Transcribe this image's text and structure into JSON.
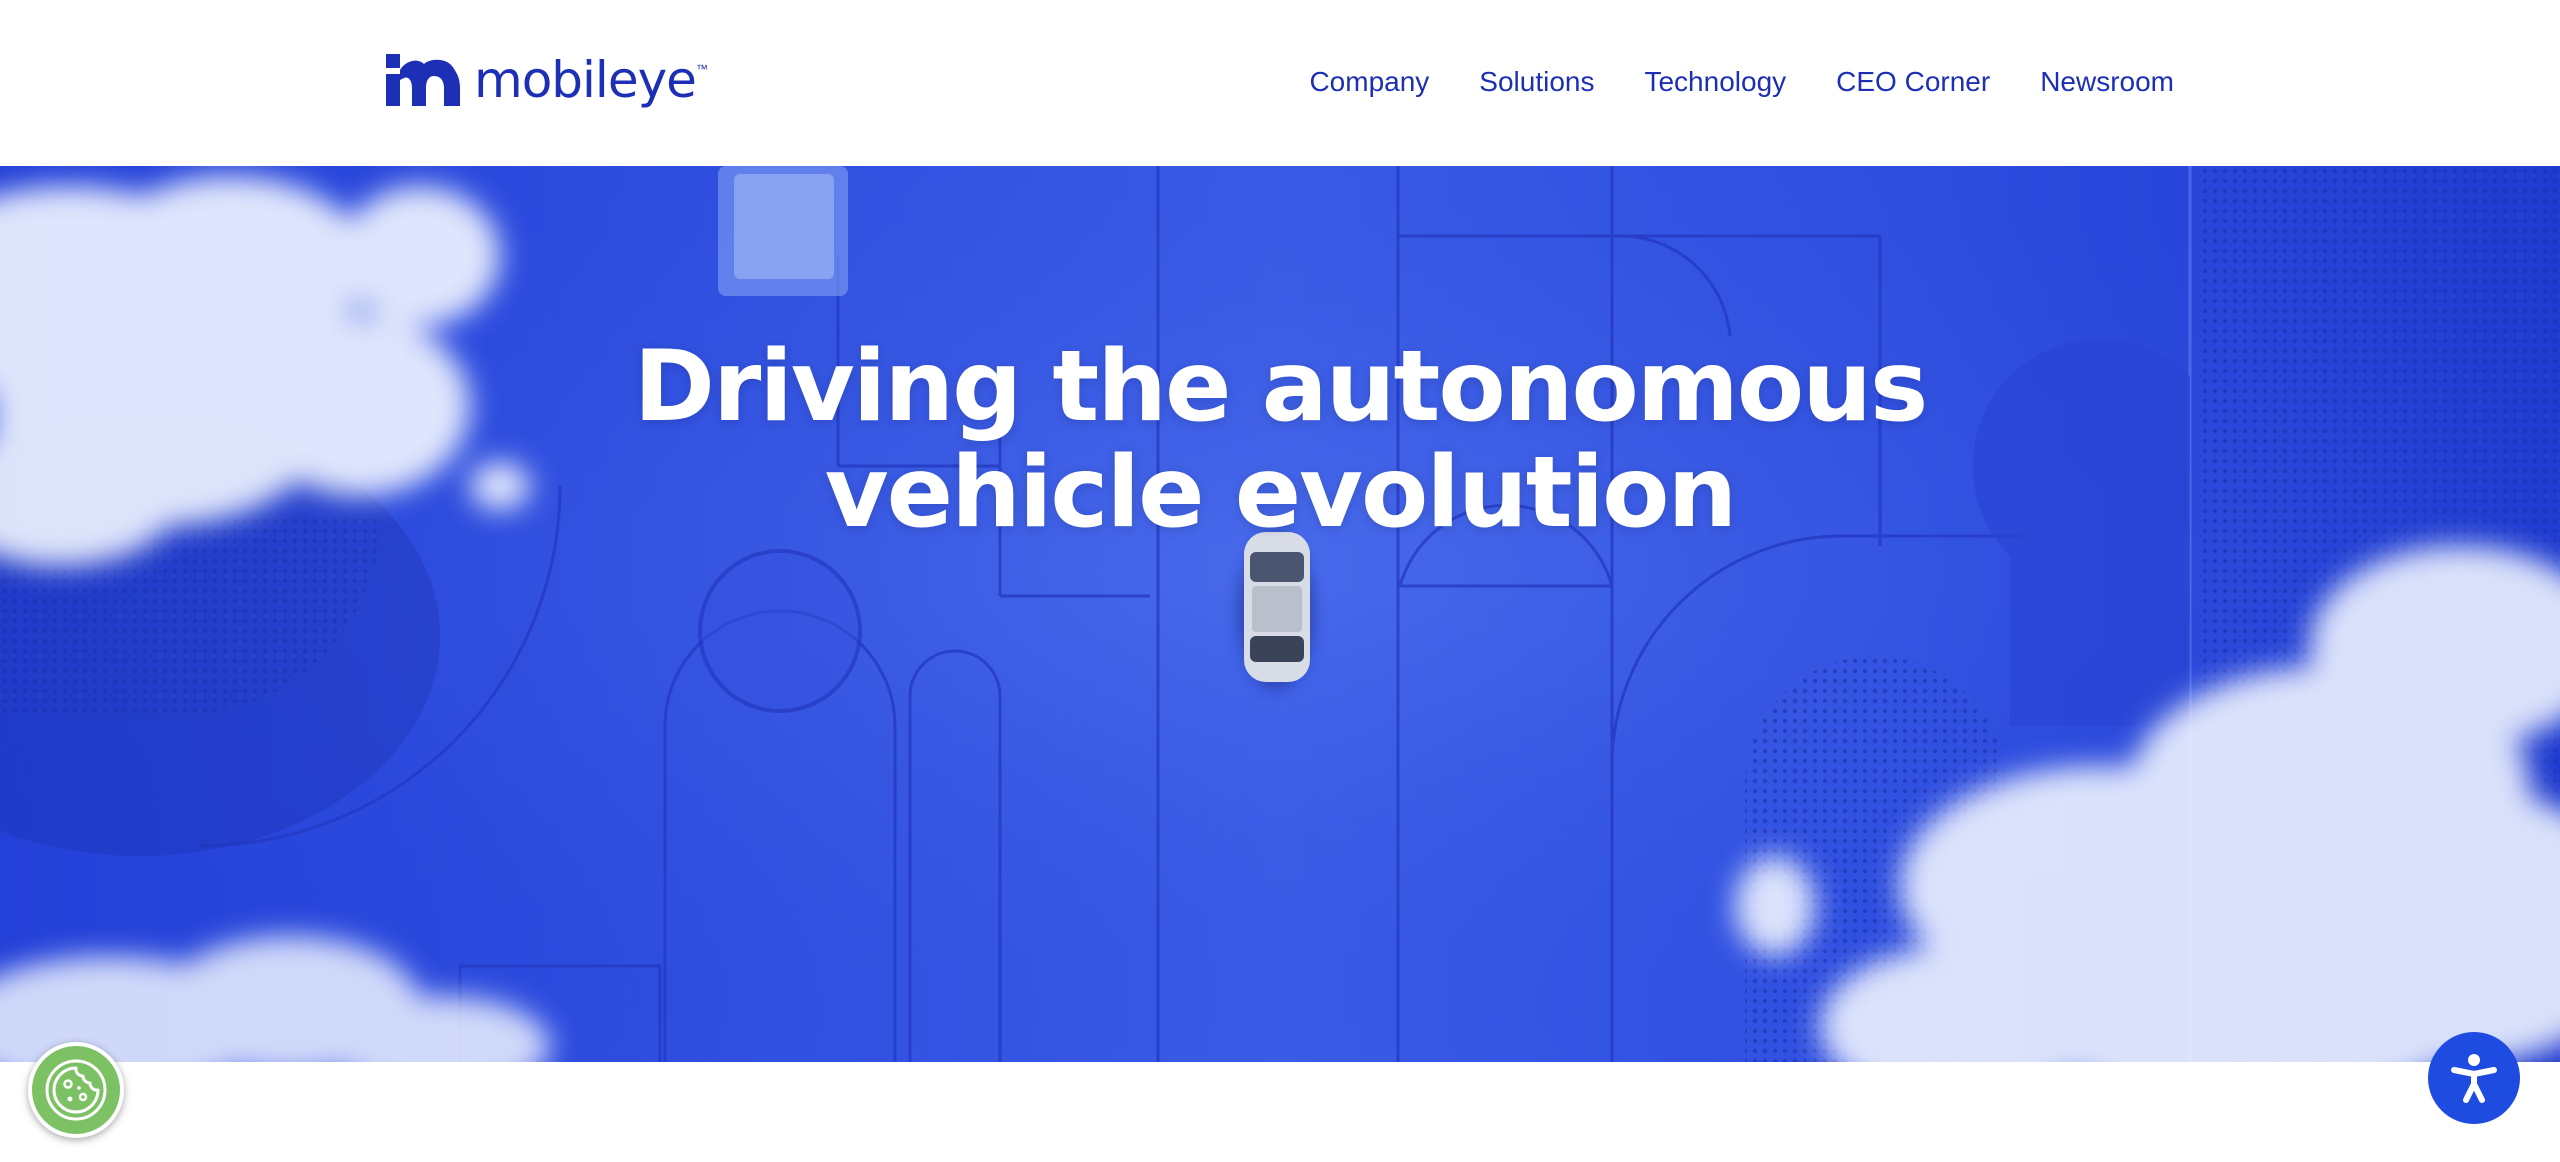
{
  "header": {
    "logo": {
      "text": "mobileye",
      "trademark": "™",
      "icon": "mobileye-m-logo"
    },
    "nav": [
      {
        "label": "Company"
      },
      {
        "label": "Solutions"
      },
      {
        "label": "Technology"
      },
      {
        "label": "CEO Corner"
      },
      {
        "label": "Newsroom"
      }
    ]
  },
  "hero": {
    "title_line1": "Driving the autonomous",
    "title_line2": "vehicle evolution",
    "image": "aerial-car-on-blue-sculpted-road-with-clouds"
  },
  "widgets": {
    "cookie_icon": "cookie-icon",
    "accessibility_icon": "accessibility-icon"
  },
  "colors": {
    "brand": "#1c2fb5",
    "hero_blue": "#3050e0",
    "cookie_green": "#7cc163",
    "accessibility_blue": "#1e4be0"
  }
}
